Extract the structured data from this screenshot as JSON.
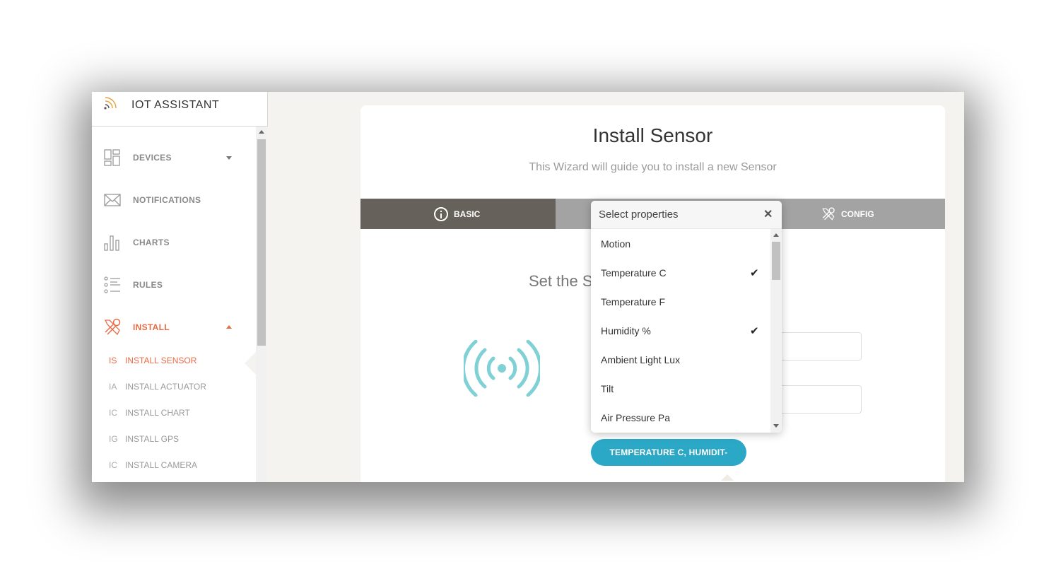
{
  "app": {
    "title": "IOT ASSISTANT",
    "logo_icon": "signal-logo-icon"
  },
  "sidebar": {
    "items": [
      {
        "label": "DEVICES",
        "icon": "grid-layout-icon",
        "caret": "down"
      },
      {
        "label": "NOTIFICATIONS",
        "icon": "envelope-icon"
      },
      {
        "label": "CHARTS",
        "icon": "bar-chart-icon"
      },
      {
        "label": "RULES",
        "icon": "list-icon"
      },
      {
        "label": "INSTALL",
        "icon": "tools-icon",
        "caret": "up",
        "active": true
      }
    ],
    "sub_items": [
      {
        "abbr": "IS",
        "label": "INSTALL SENSOR",
        "active": true
      },
      {
        "abbr": "IA",
        "label": "INSTALL ACTUATOR"
      },
      {
        "abbr": "IC",
        "label": "INSTALL CHART"
      },
      {
        "abbr": "IG",
        "label": "INSTALL GPS"
      },
      {
        "abbr": "IC",
        "label": "INSTALL CAMERA"
      }
    ]
  },
  "wizard": {
    "title": "Install Sensor",
    "subtitle": "This Wizard will guide you to install a new Sensor",
    "steps": [
      {
        "label": "BASIC",
        "icon": "info-icon",
        "active": true
      },
      {
        "label": "CONFIG",
        "icon": "tools-icon"
      }
    ],
    "section_text": "Set the S",
    "sensor_icon": "wireless-signal-icon",
    "properties_button": "TEMPERATURE C, HUMIDIT-"
  },
  "dropdown": {
    "title": "Select properties",
    "close_icon": "close-icon",
    "options": [
      {
        "label": "Motion",
        "checked": false
      },
      {
        "label": "Temperature C",
        "checked": true
      },
      {
        "label": "Temperature F",
        "checked": false
      },
      {
        "label": "Humidity %",
        "checked": true
      },
      {
        "label": "Ambient Light Lux",
        "checked": false
      },
      {
        "label": "Tilt",
        "checked": false
      },
      {
        "label": "Air Pressure Pa",
        "checked": false
      }
    ]
  },
  "colors": {
    "accent": "#e86b45",
    "step_active": "#66615b",
    "step_bar": "#a3a3a3",
    "button": "#2ca8c7",
    "sensor_icon": "#7fd1d6"
  }
}
